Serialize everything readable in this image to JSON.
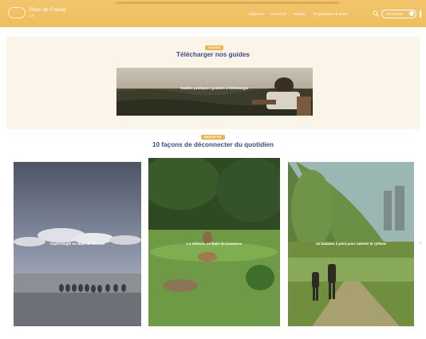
{
  "header": {
    "brand_name": "Gîtes de France",
    "brand_sub": "Lot",
    "nav": [
      "Séjourner",
      "Découvrir",
      "Guides",
      "Propriétaires & Gîtes"
    ],
    "search_placeholder": "Rechercher"
  },
  "guides_section": {
    "badge": "GUIDES",
    "title": "Télécharger nos guides",
    "banner_text": "Guides pratiques gratuits à télécharger"
  },
  "disconnect_section": {
    "badge": "BIEN-ÊTRE",
    "title": "10 façons de déconnecter du quotidien",
    "cards": [
      {
        "text": "Sophrologie en Baie de Somme"
      },
      {
        "text": "Le silence, un bain de jouvence"
      },
      {
        "text": "10 balades à pied pour ralentir le rythme"
      }
    ],
    "next_arrow": "›"
  },
  "colors": {
    "header": "#efbe5e",
    "badge": "#f2b447",
    "title": "#3f4a8a",
    "section_bg": "#fbf4e8"
  }
}
